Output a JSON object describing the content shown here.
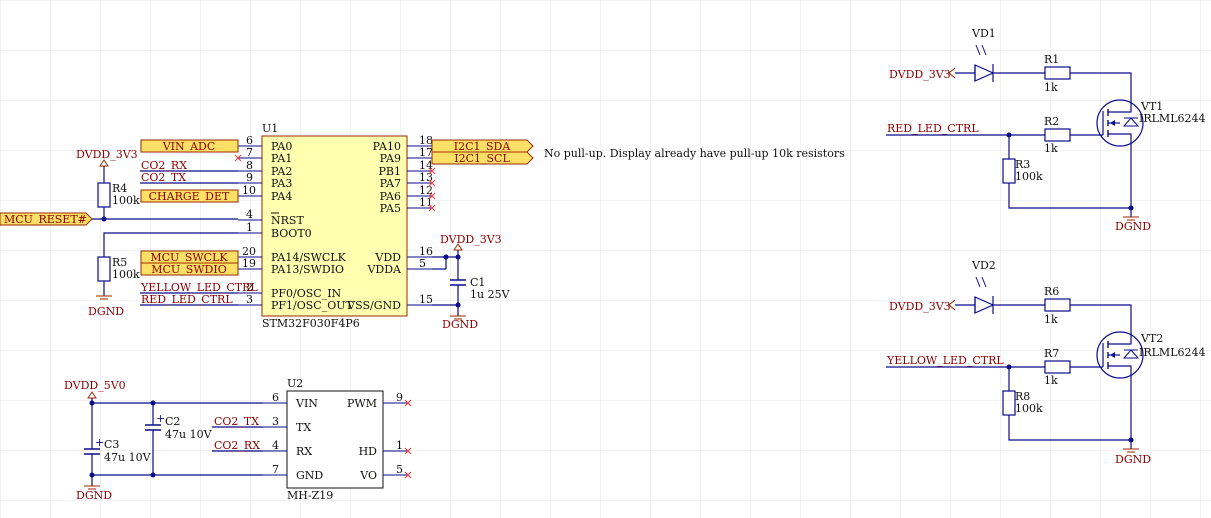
{
  "u1": {
    "ref": "U1",
    "part": "STM32F030F4P6",
    "left_pins": [
      {
        "num": "6",
        "name": "PA0"
      },
      {
        "num": "7",
        "name": "PA1"
      },
      {
        "num": "8",
        "name": "PA2"
      },
      {
        "num": "9",
        "name": "PA3"
      },
      {
        "num": "10",
        "name": "PA4"
      },
      {
        "num": "4",
        "name": "NRST"
      },
      {
        "num": "1",
        "name": "BOOT0"
      },
      {
        "num": "20",
        "name": "PA14/SWCLK"
      },
      {
        "num": "19",
        "name": "PA13/SWDIO"
      },
      {
        "num": "2",
        "name": "PF0/OSC_IN"
      },
      {
        "num": "3",
        "name": "PF1/OSC_OUT"
      }
    ],
    "right_pins": [
      {
        "num": "18",
        "name": "PA10"
      },
      {
        "num": "17",
        "name": "PA9"
      },
      {
        "num": "14",
        "name": "PB1"
      },
      {
        "num": "13",
        "name": "PA7"
      },
      {
        "num": "12",
        "name": "PA6"
      },
      {
        "num": "11",
        "name": "PA5"
      },
      {
        "num": "16",
        "name": "VDD"
      },
      {
        "num": "5",
        "name": "VDDA"
      },
      {
        "num": "15",
        "name": "VSS/GND"
      }
    ]
  },
  "u2": {
    "ref": "U2",
    "part": "MH-Z19",
    "left_pins": [
      {
        "num": "6",
        "name": "VIN"
      },
      {
        "num": "3",
        "name": "TX"
      },
      {
        "num": "4",
        "name": "RX"
      },
      {
        "num": "7",
        "name": "GND"
      }
    ],
    "right_pins": [
      {
        "num": "9",
        "name": "PWM"
      },
      {
        "num": "1",
        "name": "HD"
      },
      {
        "num": "5",
        "name": "VO"
      }
    ]
  },
  "ports": {
    "vin_adc": "VIN_ADC",
    "charge_det": "CHARGE_DET",
    "mcu_swclk": "MCU_SWCLK",
    "mcu_swdio": "MCU_SWDIO",
    "mcu_reset": "MCU_RESET#",
    "i2c1_sda": "I2C1_SDA",
    "i2c1_scl": "I2C1_SCL"
  },
  "nets": {
    "co2_rx": "CO2_RX",
    "co2_tx": "CO2_TX",
    "yellow_led_ctrl": "YELLOW_LED_CTRL",
    "red_led_ctrl": "RED_LED_CTRL",
    "dvdd_3v3": "DVDD_3V3",
    "dvdd_5v0": "DVDD_5V0",
    "dgnd": "DGND"
  },
  "note": "No pull-up. Display already have pull-up 10k resistors",
  "components": {
    "r4": {
      "ref": "R4",
      "value": "100k"
    },
    "r5": {
      "ref": "R5",
      "value": "100k"
    },
    "c1": {
      "ref": "C1",
      "value": "1u 25V"
    },
    "c2": {
      "ref": "C2",
      "value": "47u 10V"
    },
    "c3": {
      "ref": "C3",
      "value": "47u 10V"
    },
    "vd1": {
      "ref": "VD1"
    },
    "vd2": {
      "ref": "VD2"
    },
    "r1": {
      "ref": "R1",
      "value": "1k"
    },
    "r2": {
      "ref": "R2",
      "value": "1k"
    },
    "r3": {
      "ref": "R3",
      "value": "100k"
    },
    "r6": {
      "ref": "R6",
      "value": "1k"
    },
    "r7": {
      "ref": "R7",
      "value": "1k"
    },
    "r8": {
      "ref": "R8",
      "value": "100k"
    },
    "vt1": {
      "ref": "VT1",
      "value": "IRLML6244"
    },
    "vt2": {
      "ref": "VT2",
      "value": "IRLML6244"
    }
  }
}
